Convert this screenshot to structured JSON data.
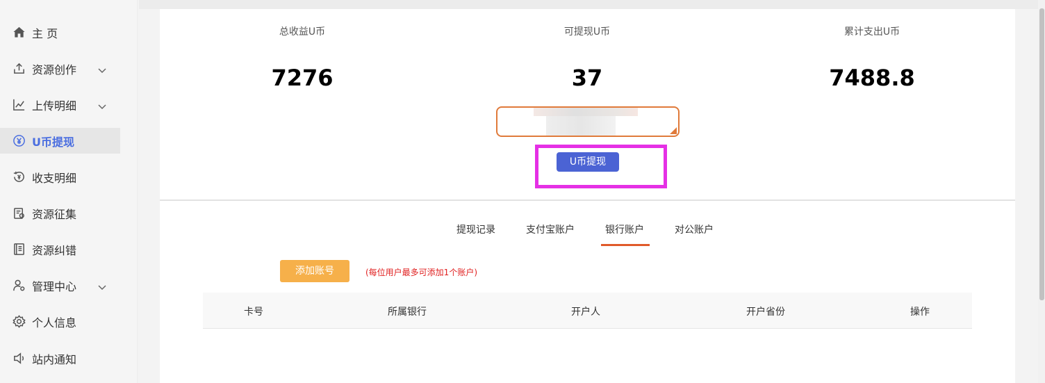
{
  "sidebar": {
    "items": [
      {
        "label": "主 页",
        "icon": "home-icon"
      },
      {
        "label": "资源创作",
        "icon": "upload-icon",
        "expandable": true
      },
      {
        "label": "上传明细",
        "icon": "line-chart-icon",
        "expandable": true
      },
      {
        "label": "U币提现",
        "icon": "yen-coin-icon",
        "active": true
      },
      {
        "label": "收支明细",
        "icon": "coin-history-icon"
      },
      {
        "label": "资源征集",
        "icon": "clipboard-icon"
      },
      {
        "label": "资源纠错",
        "icon": "ledger-icon"
      },
      {
        "label": "管理中心",
        "icon": "user-settings-icon",
        "expandable": true
      },
      {
        "label": "个人信息",
        "icon": "gear-icon"
      },
      {
        "label": "站内通知",
        "icon": "speaker-icon"
      }
    ]
  },
  "stats": {
    "total_income_label": "总收益U币",
    "total_income_value": "7276",
    "withdrawable_label": "可提现U币",
    "withdrawable_value": "37",
    "total_spent_label": "累计支出U币",
    "total_spent_value": "7488.8"
  },
  "withdraw": {
    "button_label": "U币提现"
  },
  "tabs": {
    "items": [
      "提现记录",
      "支付宝账户",
      "银行账户",
      "对公账户"
    ],
    "active": "银行账户"
  },
  "account": {
    "add_button": "添加账号",
    "note": "(每位用户最多可添加1个账户)"
  },
  "table": {
    "columns": [
      "卡号",
      "所属银行",
      "开户人",
      "开户省份",
      "操作"
    ]
  },
  "colors": {
    "accent": "#4b63d4",
    "active_nav": "#4a6ee0",
    "tab_underline": "#e05a2a",
    "add_button": "#f6b04a",
    "note": "#e02020",
    "highlight": "#e530e5"
  }
}
